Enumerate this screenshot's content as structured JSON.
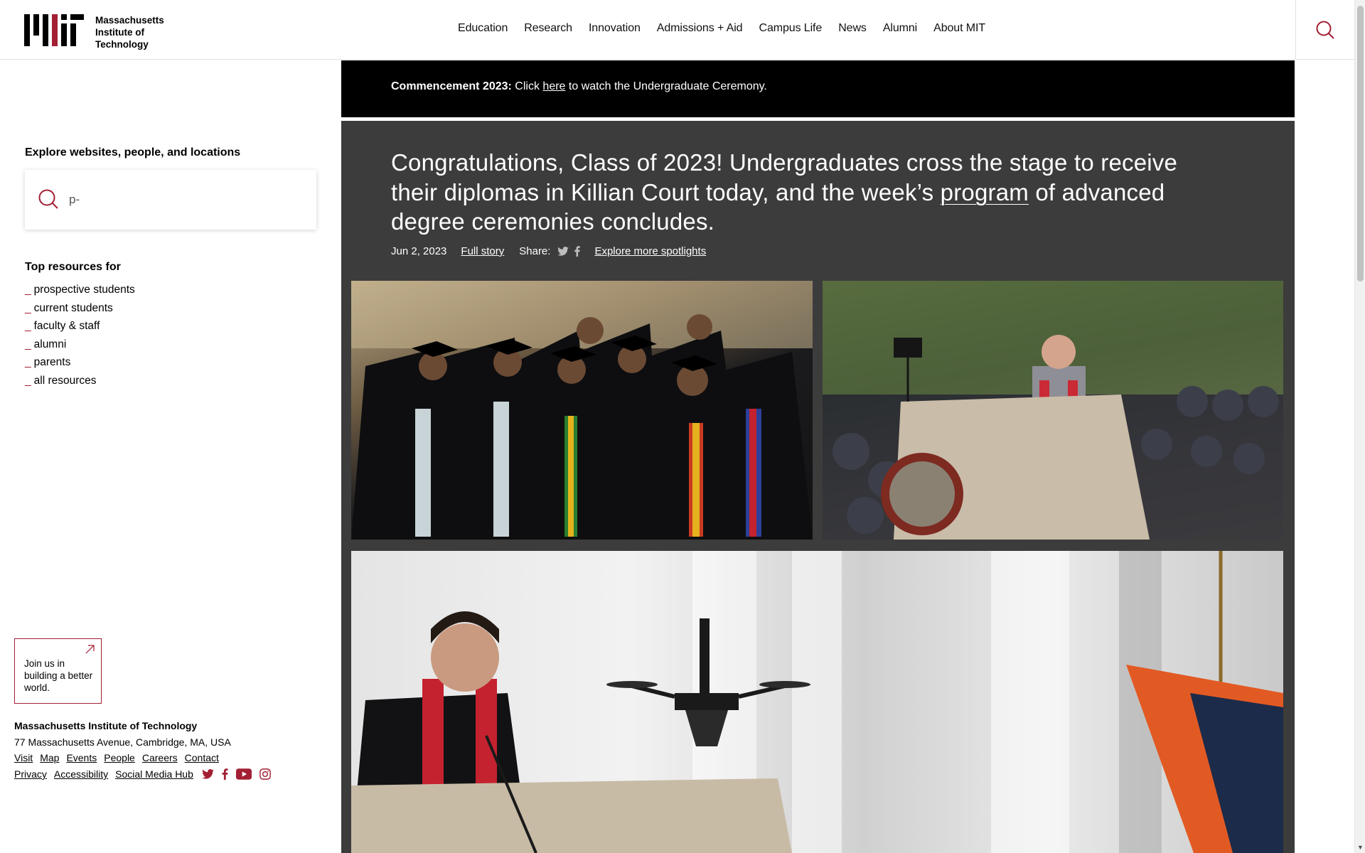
{
  "header": {
    "logo_lines": [
      "Massachusetts",
      "Institute of",
      "Technology"
    ],
    "nav": [
      "Education",
      "Research",
      "Innovation",
      "Admissions + Aid",
      "Campus Life",
      "News",
      "Alumni",
      "About MIT"
    ]
  },
  "sidebar": {
    "explore_title": "Explore websites, people, and locations",
    "search_value": "p-",
    "resources_title": "Top resources for",
    "resources": [
      "prospective students",
      "current students",
      "faculty & staff",
      "alumni",
      "parents",
      "all resources"
    ],
    "join_text": "Join us in building a better world."
  },
  "footer": {
    "name": "Massachusetts Institute of Technology",
    "address": "77 Massachusetts Avenue, Cambridge, MA, USA",
    "links_row1": [
      "Visit",
      "Map",
      "Events",
      "People",
      "Careers",
      "Contact"
    ],
    "links_row2": [
      "Privacy",
      "Accessibility",
      "Social Media Hub"
    ],
    "social_icons": [
      "twitter-icon",
      "facebook-icon",
      "youtube-icon",
      "instagram-icon"
    ]
  },
  "banner": {
    "bold": "Commencement 2023:",
    "pre_link": "Click",
    "link": "here",
    "post_link": "to watch the Undergraduate Ceremony."
  },
  "spotlight": {
    "headline_pre": "Congratulations, Class of 2023! Undergraduates cross the stage to receive their diplomas in Killian Court today, and the week’s",
    "headline_link": "program",
    "headline_post": "of advanced degree ceremonies concludes.",
    "date": "Jun 2, 2023",
    "full_story": "Full story",
    "share_label": "Share:",
    "explore_more": "Explore more spotlights"
  },
  "colors": {
    "accent": "#a31f34",
    "banner_bg": "#000000",
    "spotlight_bg": "#3c3c3c"
  }
}
